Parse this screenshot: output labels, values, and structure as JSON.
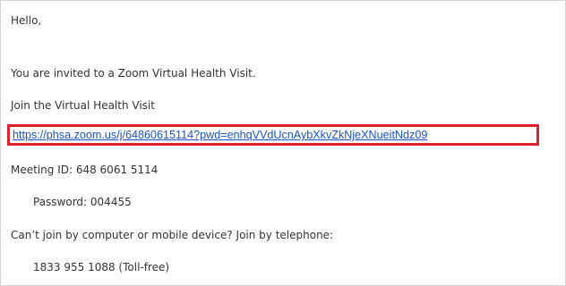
{
  "email": {
    "greeting": "Hello,",
    "invite_text": "You are invited to a Zoom Virtual Health Visit.",
    "join_prompt": "Join the Virtual Health Visit",
    "meeting_link": "https://phsa.zoom.us/j/64860615114?pwd=enhqVVdUcnAybXkvZkNjeXNueitNdz09",
    "meeting_id": "Meeting ID: 648 6061 5114",
    "password": "Password: 004455",
    "phone_prompt": "Can’t join by computer or mobile device? Join by telephone:",
    "phone_number": "1833 955 1088 (Toll-free)"
  },
  "colors": {
    "highlight_border": "#e0202a",
    "link": "#1a54c8",
    "text": "#333333"
  }
}
